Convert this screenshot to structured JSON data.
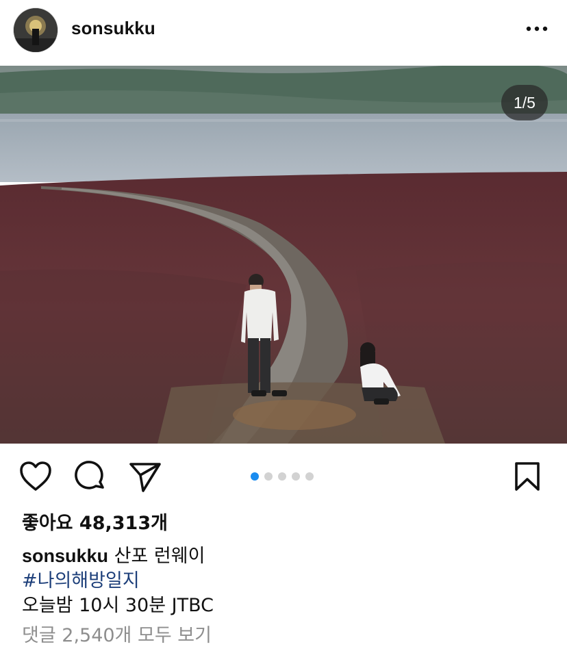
{
  "post": {
    "username": "sonsukku",
    "image_counter": "1/5",
    "likes": "좋아요 48,313개",
    "caption_text": "산포 런웨이",
    "hashtag": "#나의해방일지",
    "caption_line2": "오늘밤 10시 30분 JTBC",
    "comments_link": "댓글 2,540개 모두 보기"
  },
  "carousel": {
    "total": 5,
    "active_index": 0,
    "active_color": "#1a8cf0",
    "inactive_color": "#d2d2d2"
  },
  "icons": {
    "more": "more-horizontal-icon",
    "like": "heart-icon",
    "comment": "comment-bubble-icon",
    "share": "paper-plane-icon",
    "save": "bookmark-icon"
  }
}
